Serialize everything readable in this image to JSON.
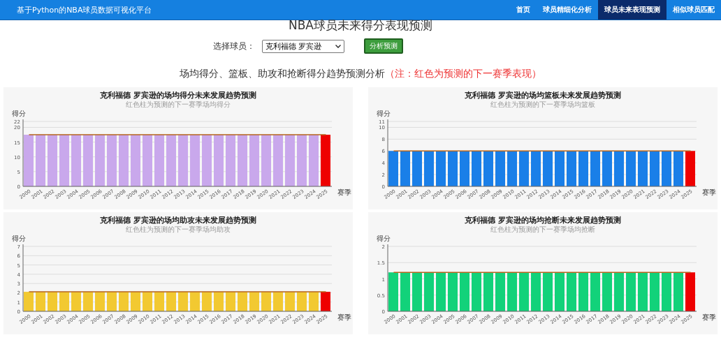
{
  "header": {
    "brand": "基于Python的NBA球员数据可视化平台",
    "nav": [
      {
        "label": "首页",
        "selected": false
      },
      {
        "label": "球员精细化分析",
        "selected": false
      },
      {
        "label": "球员未来表现预测",
        "selected": true
      },
      {
        "label": "相似球员匹配",
        "selected": false
      }
    ]
  },
  "page_title": "NBA球员未来得分表现预测",
  "player_picker": {
    "label": "选择球员：",
    "value": "克利福德 罗宾逊",
    "button": "分析预测"
  },
  "section_heading": {
    "text": "场均得分、篮板、助攻和抢断得分趋势预测分析",
    "note": "（注：红色为预测的下一赛季表现）"
  },
  "charts": [
    {
      "chart_data": {
        "type": "bar",
        "title": "克利福德 罗宾逊的场均得分未来发展趋势预测",
        "subtitle": "红色柱为预测的下一赛季场均得分",
        "xlabel": "赛季",
        "ylabel": "得分",
        "grid": true,
        "categories": [
          "2000",
          "2001",
          "2002",
          "2003",
          "2004",
          "2005",
          "2006",
          "2007",
          "2008",
          "2009",
          "2010",
          "2011",
          "2012",
          "2013",
          "2014",
          "2015",
          "2016",
          "2017",
          "2018",
          "2019",
          "2020",
          "2021",
          "2022",
          "2023",
          "2024",
          "2025"
        ],
        "ylim": [
          0,
          22
        ],
        "yticks": [
          0,
          5,
          10,
          15,
          20,
          22
        ],
        "series": [
          {
            "type": "bar",
            "color": "#c9a8ec",
            "values": [
              17.5,
              17.5,
              17.5,
              17.5,
              17.5,
              17.5,
              17.5,
              17.5,
              17.5,
              17.5,
              17.5,
              17.5,
              17.5,
              17.5,
              17.5,
              17.5,
              17.5,
              17.5,
              17.5,
              17.5,
              17.5,
              17.5,
              17.5,
              17.5,
              17.5,
              null
            ]
          },
          {
            "type": "bar",
            "color": "#ee0000",
            "values": [
              null,
              null,
              null,
              null,
              null,
              null,
              null,
              null,
              null,
              null,
              null,
              null,
              null,
              null,
              null,
              null,
              null,
              null,
              null,
              null,
              null,
              null,
              null,
              null,
              null,
              17.5
            ]
          },
          {
            "type": "line",
            "color": "#b5651d",
            "values": [
              17.5,
              17.5,
              17.5,
              17.5,
              17.5,
              17.5,
              17.5,
              17.5,
              17.5,
              17.5,
              17.5,
              17.5,
              17.5,
              17.5,
              17.5,
              17.5,
              17.5,
              17.5,
              17.5,
              17.5,
              17.5,
              17.5,
              17.5,
              17.5,
              17.5,
              17.5
            ]
          }
        ]
      }
    },
    {
      "chart_data": {
        "type": "bar",
        "title": "克利福德 罗宾逊的场均篮板未来发展趋势预测",
        "subtitle": "红色柱为预测的下一赛季场均篮板",
        "xlabel": "赛季",
        "ylabel": "得分",
        "grid": true,
        "categories": [
          "2000",
          "2001",
          "2002",
          "2003",
          "2004",
          "2005",
          "2006",
          "2007",
          "2008",
          "2009",
          "2010",
          "2011",
          "2012",
          "2013",
          "2014",
          "2015",
          "2016",
          "2017",
          "2018",
          "2019",
          "2020",
          "2021",
          "2022",
          "2023",
          "2024",
          "2025"
        ],
        "ylim": [
          0,
          11
        ],
        "yticks": [
          0,
          2,
          4,
          6,
          8,
          10,
          11
        ],
        "series": [
          {
            "type": "bar",
            "color": "#1a7fe8",
            "values": [
              6,
              6,
              6,
              6,
              6,
              6,
              6,
              6,
              6,
              6,
              6,
              6,
              6,
              6,
              6,
              6,
              6,
              6,
              6,
              6,
              6,
              6,
              6,
              6,
              6,
              null
            ]
          },
          {
            "type": "bar",
            "color": "#ee0000",
            "values": [
              null,
              null,
              null,
              null,
              null,
              null,
              null,
              null,
              null,
              null,
              null,
              null,
              null,
              null,
              null,
              null,
              null,
              null,
              null,
              null,
              null,
              null,
              null,
              null,
              null,
              6
            ]
          },
          {
            "type": "line",
            "color": "#b5651d",
            "values": [
              6,
              6,
              6,
              6,
              6,
              6,
              6,
              6,
              6,
              6,
              6,
              6,
              6,
              6,
              6,
              6,
              6,
              6,
              6,
              6,
              6,
              6,
              6,
              6,
              6,
              6
            ]
          }
        ]
      }
    },
    {
      "chart_data": {
        "type": "bar",
        "title": "克利福德 罗宾逊的场均助攻未来发展趋势预测",
        "subtitle": "红色柱为预测的下一赛季场均助攻",
        "xlabel": "赛季",
        "ylabel": "得分",
        "grid": true,
        "categories": [
          "2000",
          "2001",
          "2002",
          "2003",
          "2004",
          "2005",
          "2006",
          "2007",
          "2008",
          "2009",
          "2010",
          "2011",
          "2012",
          "2013",
          "2014",
          "2015",
          "2016",
          "2017",
          "2018",
          "2019",
          "2020",
          "2021",
          "2022",
          "2023",
          "2024",
          "2025"
        ],
        "ylim": [
          0,
          7
        ],
        "yticks": [
          0,
          1,
          2,
          3,
          4,
          5,
          6,
          7
        ],
        "series": [
          {
            "type": "bar",
            "color": "#f2c931",
            "values": [
              2.1,
              2.1,
              2.1,
              2.1,
              2.1,
              2.1,
              2.1,
              2.1,
              2.1,
              2.1,
              2.1,
              2.1,
              2.1,
              2.1,
              2.1,
              2.1,
              2.1,
              2.1,
              2.1,
              2.1,
              2.1,
              2.1,
              2.1,
              2.1,
              2.1,
              null
            ]
          },
          {
            "type": "bar",
            "color": "#ee0000",
            "values": [
              null,
              null,
              null,
              null,
              null,
              null,
              null,
              null,
              null,
              null,
              null,
              null,
              null,
              null,
              null,
              null,
              null,
              null,
              null,
              null,
              null,
              null,
              null,
              null,
              null,
              2.1
            ]
          },
          {
            "type": "line",
            "color": "#b5651d",
            "values": [
              2.1,
              2.1,
              2.1,
              2.1,
              2.1,
              2.1,
              2.1,
              2.1,
              2.1,
              2.1,
              2.1,
              2.1,
              2.1,
              2.1,
              2.1,
              2.1,
              2.1,
              2.1,
              2.1,
              2.1,
              2.1,
              2.1,
              2.1,
              2.1,
              2.1,
              2.1
            ]
          }
        ]
      }
    },
    {
      "chart_data": {
        "type": "bar",
        "title": "克利福德 罗宾逊的场均抢断未来发展趋势预测",
        "subtitle": "红色柱为预测的下一赛季场均抢断",
        "xlabel": "赛季",
        "ylabel": "得分",
        "grid": true,
        "categories": [
          "2000",
          "2001",
          "2002",
          "2003",
          "2004",
          "2005",
          "2006",
          "2007",
          "2008",
          "2009",
          "2010",
          "2011",
          "2012",
          "2013",
          "2014",
          "2015",
          "2016",
          "2017",
          "2018",
          "2019",
          "2020",
          "2021",
          "2022",
          "2023",
          "2024",
          "2025"
        ],
        "ylim": [
          0,
          2
        ],
        "yticks": [
          0,
          0.5,
          1,
          1.5,
          2
        ],
        "series": [
          {
            "type": "bar",
            "color": "#12d27a",
            "values": [
              1.2,
              1.2,
              1.2,
              1.2,
              1.2,
              1.2,
              1.2,
              1.2,
              1.2,
              1.2,
              1.2,
              1.2,
              1.2,
              1.2,
              1.2,
              1.2,
              1.2,
              1.2,
              1.2,
              1.2,
              1.2,
              1.2,
              1.2,
              1.2,
              1.2,
              null
            ]
          },
          {
            "type": "bar",
            "color": "#ee0000",
            "values": [
              null,
              null,
              null,
              null,
              null,
              null,
              null,
              null,
              null,
              null,
              null,
              null,
              null,
              null,
              null,
              null,
              null,
              null,
              null,
              null,
              null,
              null,
              null,
              null,
              null,
              1.2
            ]
          },
          {
            "type": "line",
            "color": "#b5651d",
            "values": [
              1.2,
              1.2,
              1.2,
              1.2,
              1.2,
              1.2,
              1.2,
              1.2,
              1.2,
              1.2,
              1.2,
              1.2,
              1.2,
              1.2,
              1.2,
              1.2,
              1.2,
              1.2,
              1.2,
              1.2,
              1.2,
              1.2,
              1.2,
              1.2,
              1.2,
              1.2
            ]
          }
        ]
      }
    }
  ]
}
